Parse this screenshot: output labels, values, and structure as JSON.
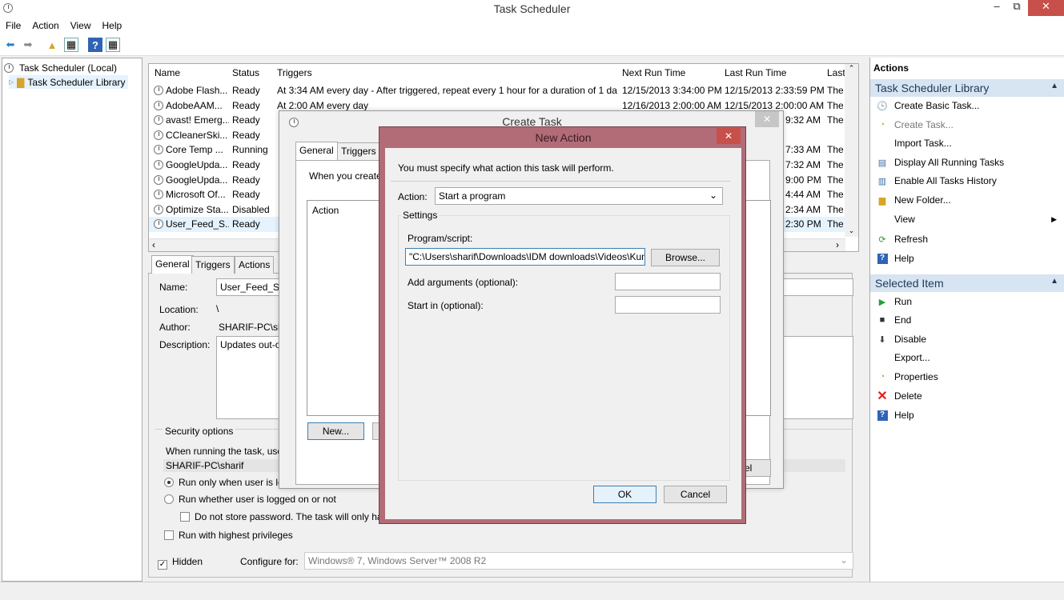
{
  "window": {
    "title": "Task Scheduler",
    "minimize": "–",
    "maximize": "⧉",
    "close": "✕"
  },
  "menu": [
    "File",
    "Action",
    "View",
    "Help"
  ],
  "tree": {
    "root": "Task Scheduler (Local)",
    "child": "Task Scheduler Library"
  },
  "table": {
    "columns": [
      "Name",
      "Status",
      "Triggers",
      "Next Run Time",
      "Last Run Time",
      "Last"
    ],
    "rows": [
      {
        "name": "Adobe Flash...",
        "status": "Ready",
        "triggers": "At 3:34 AM every day - After triggered, repeat every 1 hour for a duration of 1 day.",
        "next": "12/15/2013 3:34:00 PM",
        "last": "12/15/2013 2:33:59 PM",
        "result": "The"
      },
      {
        "name": "AdobeAAM...",
        "status": "Ready",
        "triggers": "At 2:00 AM every day",
        "next": "12/16/2013 2:00:00 AM",
        "last": "12/15/2013 2:00:00 AM",
        "result": "The"
      },
      {
        "name": "avast! Emerg...",
        "status": "Ready",
        "triggers": "",
        "next": "",
        "last": "9:32 AM",
        "result": "The"
      },
      {
        "name": "CCleanerSki...",
        "status": "Ready",
        "triggers": "",
        "next": "",
        "last": "",
        "result": ""
      },
      {
        "name": "Core Temp ...",
        "status": "Running",
        "triggers": "",
        "next": "",
        "last": "7:33 AM",
        "result": "The"
      },
      {
        "name": "GoogleUpda...",
        "status": "Ready",
        "triggers": "",
        "next": "",
        "last": "7:32 AM",
        "result": "The"
      },
      {
        "name": "GoogleUpda...",
        "status": "Ready",
        "triggers": "",
        "next": "",
        "last": "9:00 PM",
        "result": "The"
      },
      {
        "name": "Microsoft Of...",
        "status": "Ready",
        "triggers": "",
        "next": "",
        "last": "4:44 AM",
        "result": "The"
      },
      {
        "name": "Optimize Sta...",
        "status": "Disabled",
        "triggers": "",
        "next": "",
        "last": "2:34 AM",
        "result": "The"
      },
      {
        "name": "User_Feed_S...",
        "status": "Ready",
        "triggers": "",
        "next": "",
        "last": "2:30 PM",
        "result": "The"
      }
    ]
  },
  "lower": {
    "tabs": [
      "General",
      "Triggers",
      "Actions"
    ],
    "name_label": "Name:",
    "name_value": "User_Feed_Syn",
    "location_label": "Location:",
    "location_value": "\\",
    "author_label": "Author:",
    "author_value": "SHARIF-PC\\sh",
    "description_label": "Description:",
    "description_value": "Updates out-o",
    "security_title": "Security options",
    "running_text": "When running the task, use",
    "user_account": "SHARIF-PC\\sharif",
    "radio1": "Run only when user is lo",
    "radio2": "Run whether user is logged on or not",
    "check_password": "Do not store password.  The task will only ha",
    "check_highest": "Run with highest privileges",
    "hidden_label": "Hidden",
    "configure_label": "Configure for:",
    "configure_value": "Windows® 7, Windows Server™ 2008 R2"
  },
  "create_task": {
    "title": "Create Task",
    "tabs": [
      "General",
      "Triggers"
    ],
    "intro": "When you create",
    "action_col": "Action",
    "new_button": "New...",
    "cancel_partial": "el"
  },
  "new_action": {
    "title": "New Action",
    "instruction": "You must specify what action this task will perform.",
    "action_label": "Action:",
    "action_value": "Start a program",
    "settings_label": "Settings",
    "program_label": "Program/script:",
    "program_value": "\"C:\\Users\\sharif\\Downloads\\IDM downloads\\Videos\\Kun",
    "browse_button": "Browse...",
    "args_label": "Add arguments (optional):",
    "startin_label": "Start in (optional):",
    "ok_button": "OK",
    "cancel_button": "Cancel"
  },
  "actions_pane": {
    "title": "Actions",
    "section1": "Task Scheduler Library",
    "items1": [
      "Create Basic Task...",
      "Create Task...",
      "Import Task...",
      "Display All Running Tasks",
      "Enable All Tasks History",
      "New Folder...",
      "View",
      "Refresh",
      "Help"
    ],
    "section2": "Selected Item",
    "items2": [
      "Run",
      "End",
      "Disable",
      "Export...",
      "Properties",
      "Delete",
      "Help"
    ]
  }
}
